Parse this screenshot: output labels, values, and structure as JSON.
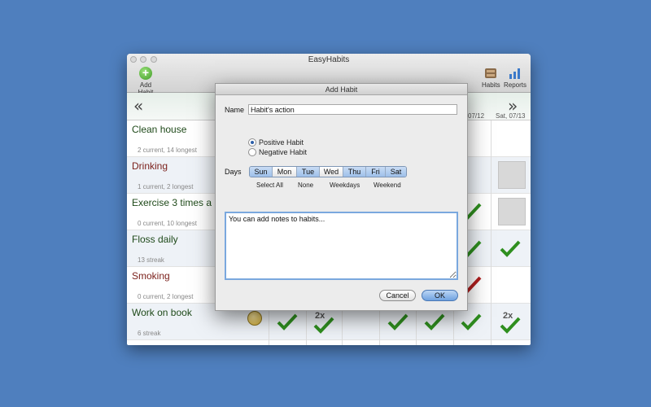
{
  "window": {
    "title": "EasyHabits",
    "toolbar": {
      "add_label": "Add Habit",
      "habits_label": "Habits",
      "reports_label": "Reports"
    },
    "columns": [
      "07/12",
      "Sat, 07/13"
    ],
    "habits": [
      {
        "name": "Clean house",
        "sub": "2 current, 14 longest",
        "kind": "positive"
      },
      {
        "name": "Drinking",
        "sub": "1 current, 2 longest",
        "kind": "negative"
      },
      {
        "name": "Exercise 3 times a",
        "sub": "0 current, 10 longest",
        "kind": "positive"
      },
      {
        "name": "Floss daily",
        "sub": "13 streak",
        "kind": "positive"
      },
      {
        "name": "Smoking",
        "sub": "0 current, 2 longest",
        "kind": "negative"
      },
      {
        "name": "Work on book",
        "sub": "6 streak",
        "kind": "positive"
      }
    ],
    "marks": {
      "twox": "2x"
    }
  },
  "dialog": {
    "title": "Add Habit",
    "name_label": "Name",
    "name_value": "Habit's action",
    "positive_label": "Positive Habit",
    "negative_label": "Negative Habit",
    "selected_type": "positive",
    "days_label": "Days",
    "days": [
      {
        "label": "Sun",
        "selected": true
      },
      {
        "label": "Mon",
        "selected": false
      },
      {
        "label": "Tue",
        "selected": true
      },
      {
        "label": "Wed",
        "selected": false
      },
      {
        "label": "Thu",
        "selected": true
      },
      {
        "label": "Fri",
        "selected": true
      },
      {
        "label": "Sat",
        "selected": true
      }
    ],
    "quick": {
      "select_all": "Select All",
      "none": "None",
      "weekdays": "Weekdays",
      "weekend": "Weekend"
    },
    "notes_value": "You can add notes to habits...",
    "cancel_label": "Cancel",
    "ok_label": "OK"
  },
  "colors": {
    "desktop": "#4f7fbe",
    "check_green": "#2f8f1f",
    "check_red": "#b01e1e",
    "positive_text": "#1f4a1a",
    "negative_text": "#7a1f1a"
  }
}
